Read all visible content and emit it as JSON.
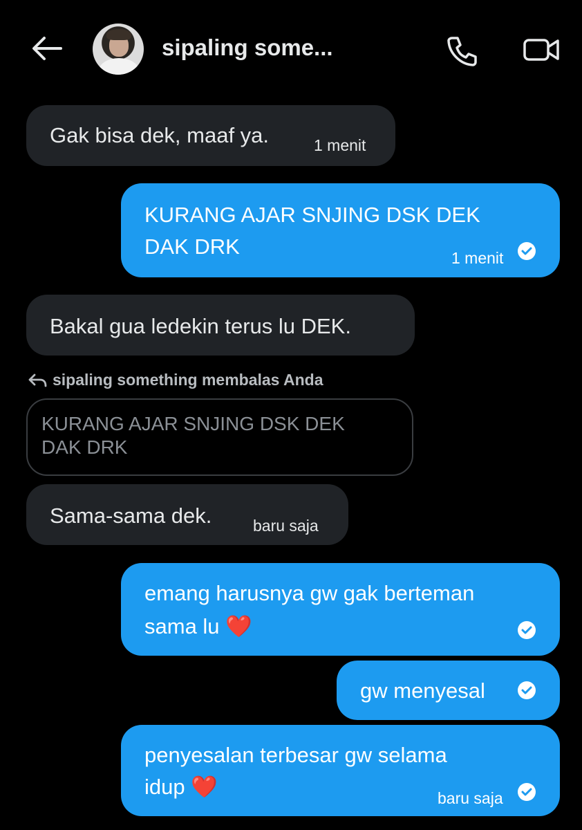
{
  "header": {
    "title": "sipaling some...",
    "back_icon": "arrow-left-icon",
    "call_icon": "phone-icon",
    "video_icon": "video-camera-icon"
  },
  "messages": [
    {
      "direction": "in",
      "text": "Gak bisa dek, maaf ya.",
      "time": "1 menit"
    },
    {
      "direction": "out",
      "text_line1": "KURANG AJAR SNJING DSK DEK",
      "text_line2": "DAK DRK",
      "time": "1 menit",
      "status_icon": "check-circle-icon"
    },
    {
      "direction": "in",
      "text": "Bakal gua ledekin terus lu DEK."
    },
    {
      "direction": "in",
      "reply_label": "sipaling something membalas Anda",
      "quoted_line1": "KURANG AJAR SNJING DSK DEK",
      "quoted_line2": "DAK DRK",
      "text": "Sama-sama dek.",
      "time": "baru saja"
    },
    {
      "direction": "out",
      "text_line1": "emang harusnya gw gak berteman",
      "text_line2": "sama lu",
      "emoji": "❤️",
      "status_icon": "check-circle-icon"
    },
    {
      "direction": "out",
      "text": "gw menyesal",
      "status_icon": "check-circle-icon"
    },
    {
      "direction": "out",
      "text_line1": "penyesalan terbesar gw selama",
      "text_line2": "idup",
      "emoji": "❤️",
      "time": "baru saja",
      "status_icon": "check-circle-icon"
    }
  ],
  "colors": {
    "background": "#000000",
    "incoming_bubble": "#202327",
    "outgoing_bubble": "#1d9bf0",
    "text": "#e7e9ea"
  }
}
